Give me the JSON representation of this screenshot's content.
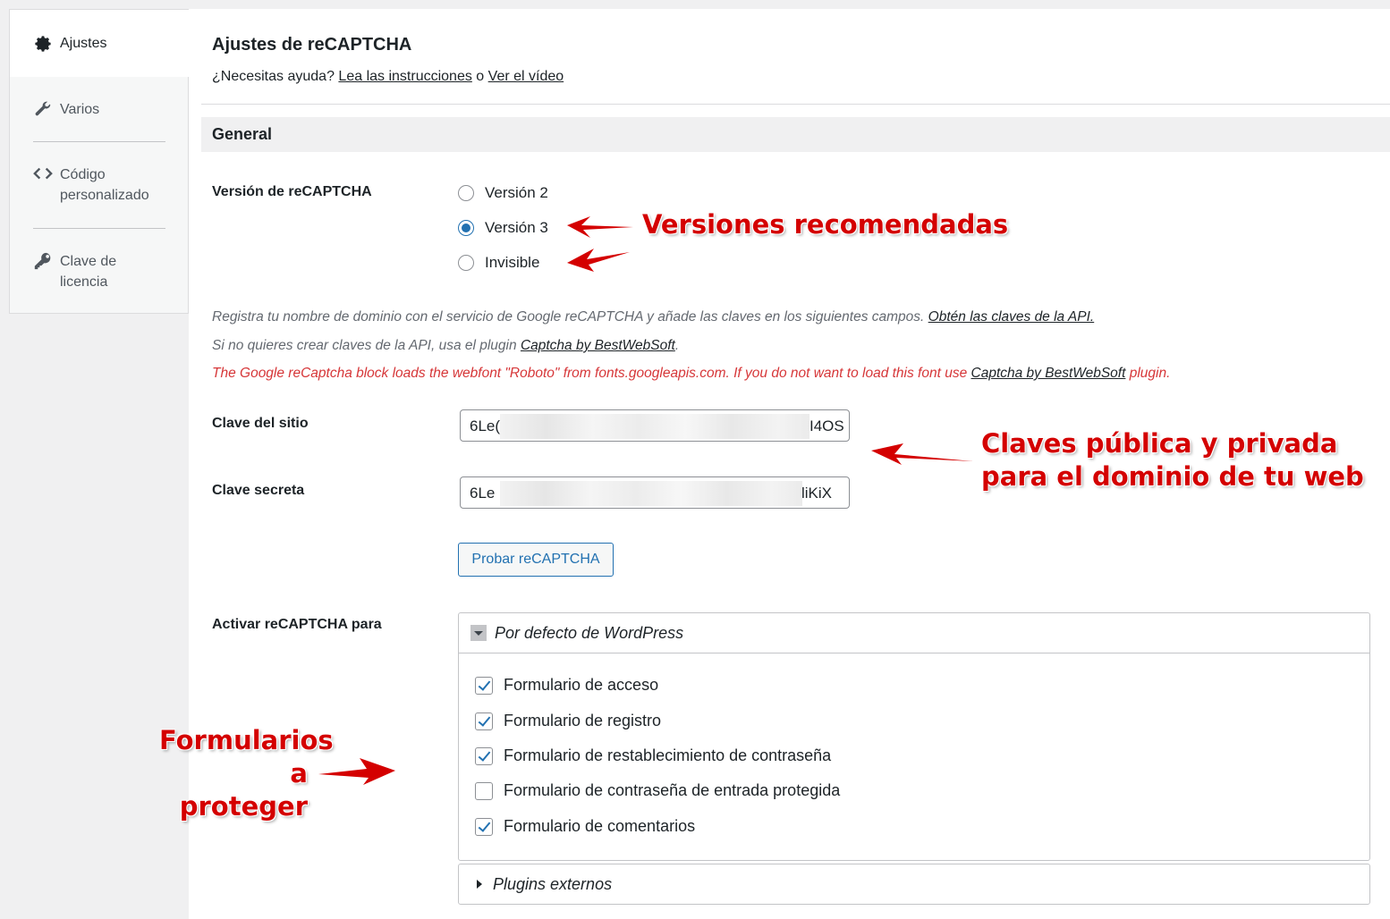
{
  "sidebar": {
    "items": [
      {
        "label": "Ajustes",
        "icon": "gear-icon"
      },
      {
        "label": "Varios",
        "icon": "wrench-icon"
      },
      {
        "label_line1": "Código",
        "label_line2": "personalizado",
        "icon": "code-icon"
      },
      {
        "label_line1": "Clave de",
        "label_line2": "licencia",
        "icon": "key-icon"
      }
    ]
  },
  "header": {
    "title": "Ajustes de reCAPTCHA",
    "help_prefix": "¿Necesitas ayuda?",
    "link_instructions": "Lea las instrucciones",
    "help_or": "o",
    "link_video": "Ver el vídeo"
  },
  "section": {
    "title": "General"
  },
  "version": {
    "label": "Versión de reCAPTCHA",
    "options": [
      "Versión 2",
      "Versión 3",
      "Invisible"
    ],
    "selected": "Versión 3"
  },
  "notes": {
    "line1": "Registra tu nombre de dominio con el servicio de Google reCAPTCHA y añade las claves en los siguientes campos.",
    "line1_link": "Obtén las claves de la API.",
    "line2_prefix": "Si no quieres crear claves de la API, usa el plugin",
    "line2_link": "Captcha by BestWebSoft",
    "line2_suffix": ".",
    "line3_prefix": "The Google reCaptcha block loads the webfont \"Roboto\" from fonts.googleapis.com. If you do not want to load this font use",
    "line3_link": "Captcha by BestWebSoft",
    "line3_suffix": "plugin."
  },
  "keys": {
    "site_label": "Clave del sitio",
    "site_value_start": "6Le(",
    "site_value_end": "I4OS",
    "secret_label": "Clave secreta",
    "secret_value_start": "6Le",
    "secret_value_end": "liKiX"
  },
  "test_button": "Probar reCAPTCHA",
  "enable": {
    "label": "Activar reCAPTCHA para",
    "group_title": "Por defecto de WordPress",
    "forms": [
      {
        "label": "Formulario de acceso",
        "checked": true
      },
      {
        "label": "Formulario de registro",
        "checked": true
      },
      {
        "label": "Formulario de restablecimiento de contraseña",
        "checked": true
      },
      {
        "label": "Formulario de contraseña de entrada protegida",
        "checked": false
      },
      {
        "label": "Formulario de comentarios",
        "checked": true
      }
    ],
    "external_title": "Plugins externos"
  },
  "annotations": {
    "versions": "Versiones recomendadas",
    "keys_line1": "Claves pública y privada",
    "keys_line2": "para el dominio de tu web",
    "forms_line1": "Formularios",
    "forms_line2": "a",
    "forms_line3": "proteger"
  },
  "colors": {
    "accent": "#2271b1",
    "annotation": "#d40000",
    "notice_red": "#d63638"
  }
}
